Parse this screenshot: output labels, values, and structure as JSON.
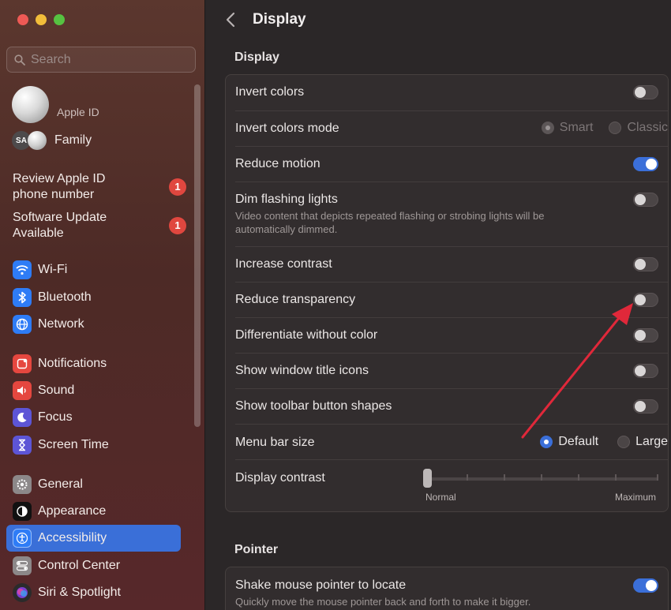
{
  "window": {
    "title": "Display"
  },
  "colors": {
    "accent": "#3b6fd9",
    "badge": "#e0473f",
    "arrow": "#e0283a"
  },
  "sidebar": {
    "search_placeholder": "Search",
    "apple_id_label": "Apple ID",
    "family_label": "Family",
    "family_initials": "SA",
    "notices": [
      {
        "line1": "Review Apple ID",
        "line2": "phone number",
        "badge": "1"
      },
      {
        "line1": "Software Update",
        "line2": "Available",
        "badge": "1"
      }
    ],
    "items": [
      {
        "label": "Wi-Fi",
        "icon": "wifi-icon",
        "color": "#2e7cf6"
      },
      {
        "label": "Bluetooth",
        "icon": "bluetooth-icon",
        "color": "#2e7cf6"
      },
      {
        "label": "Network",
        "icon": "globe-icon",
        "color": "#2e7cf6"
      },
      {
        "label": "Notifications",
        "icon": "bell-icon",
        "color": "#e5473f"
      },
      {
        "label": "Sound",
        "icon": "speaker-icon",
        "color": "#e5473f"
      },
      {
        "label": "Focus",
        "icon": "moon-icon",
        "color": "#5d55d6"
      },
      {
        "label": "Screen Time",
        "icon": "hourglass-icon",
        "color": "#5d55d6"
      },
      {
        "label": "General",
        "icon": "gear-icon",
        "color": "#8c8889"
      },
      {
        "label": "Appearance",
        "icon": "appearance-icon",
        "color": "#111111"
      },
      {
        "label": "Accessibility",
        "icon": "accessibility-icon",
        "color": "#2e7cf6"
      },
      {
        "label": "Control Center",
        "icon": "switches-icon",
        "color": "#8c8889"
      },
      {
        "label": "Siri & Spotlight",
        "icon": "siri-icon",
        "color": "#2b2b2b"
      }
    ],
    "selected": "Accessibility"
  },
  "main": {
    "back_label": "‹",
    "display_section": {
      "title": "Display",
      "rows": [
        {
          "label": "Invert colors",
          "toggle": false
        },
        {
          "label": "Invert colors mode",
          "options": [
            "Smart",
            "Classic"
          ],
          "selected": "Smart",
          "disabled": true
        },
        {
          "label": "Reduce motion",
          "toggle": true
        },
        {
          "label": "Dim flashing lights",
          "toggle": false,
          "description": "Video content that depicts repeated flashing or strobing lights will be automatically dimmed."
        },
        {
          "label": "Increase contrast",
          "toggle": false
        },
        {
          "label": "Reduce transparency",
          "toggle": false
        },
        {
          "label": "Differentiate without color",
          "toggle": false
        },
        {
          "label": "Show window title icons",
          "toggle": false
        },
        {
          "label": "Show toolbar button shapes",
          "toggle": false
        },
        {
          "label": "Menu bar size",
          "options": [
            "Default",
            "Large"
          ],
          "selected": "Default"
        },
        {
          "label": "Display contrast",
          "slider": {
            "min_label": "Normal",
            "max_label": "Maximum",
            "value": 0
          }
        }
      ]
    },
    "pointer_section": {
      "title": "Pointer",
      "rows": [
        {
          "label": "Shake mouse pointer to locate",
          "toggle": true,
          "description": "Quickly move the mouse pointer back and forth to make it bigger."
        }
      ]
    }
  }
}
